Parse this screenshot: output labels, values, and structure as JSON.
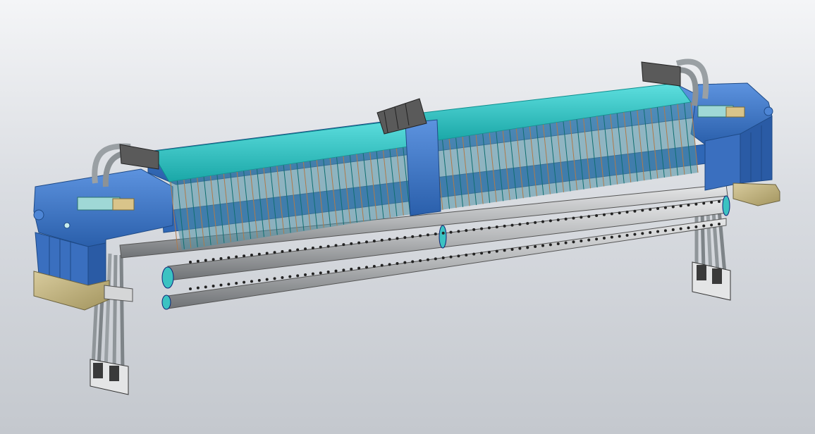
{
  "viewport": {
    "label": "",
    "background_top": "#f4f5f7",
    "background_bottom": "#c4c8ce"
  },
  "model": {
    "frame_color": "#3f78c9",
    "frame_dark": "#23569c",
    "plate_color": "#30c6c6",
    "plate_dark": "#0f8e8e",
    "pipe_color": "#b6b8b9",
    "timber_color": "#c2b384",
    "cable_color": "#8f9599",
    "plate_count_per_bay": 38
  }
}
